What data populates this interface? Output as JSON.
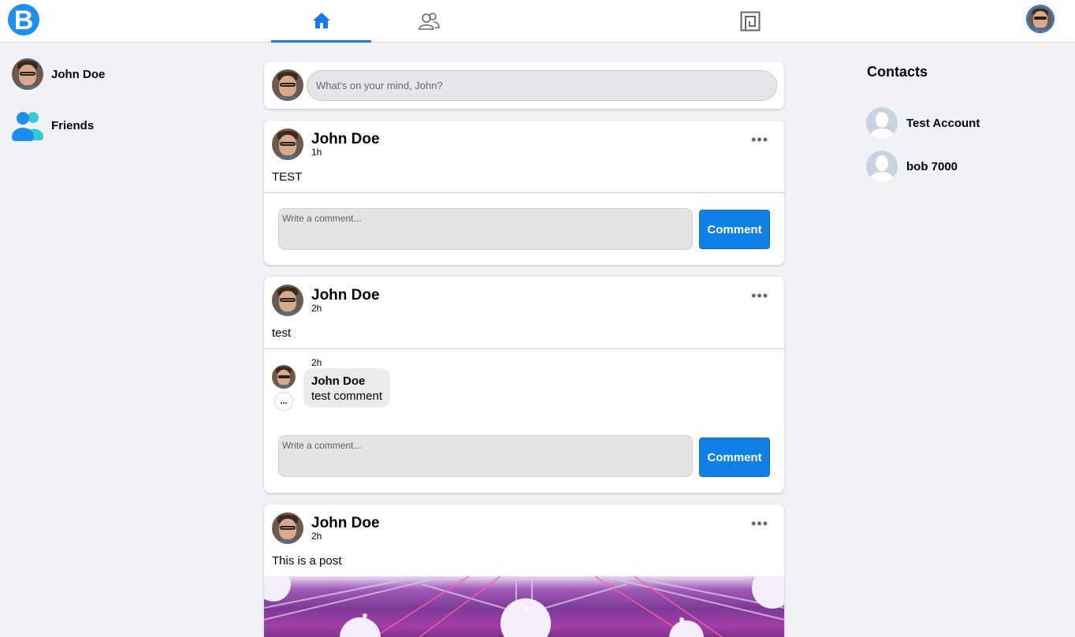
{
  "app": {
    "logo_letter": "B",
    "accent_color": "#1877f2",
    "comment_button_color": "#1080e8"
  },
  "nav": {
    "tabs": [
      {
        "name": "home",
        "icon": "home-icon",
        "active": true
      },
      {
        "name": "friends",
        "icon": "people-icon",
        "active": false
      },
      {
        "name": "marketplace",
        "icon": "square-frame-icon",
        "active": false
      }
    ]
  },
  "sidebar": {
    "items": [
      {
        "label": "John Doe",
        "icon": "avatar"
      },
      {
        "label": "Friends",
        "icon": "friends-icon"
      }
    ]
  },
  "composer": {
    "placeholder": "What's on your mind, John?"
  },
  "posts": [
    {
      "author": "John Doe",
      "time": "1h",
      "text": "TEST",
      "comments": [],
      "comment_placeholder": "Write a comment...",
      "comment_button": "Comment"
    },
    {
      "author": "John Doe",
      "time": "2h",
      "text": "test",
      "comments": [
        {
          "time": "2h",
          "author": "John Doe",
          "text": "test comment",
          "more": "..."
        }
      ],
      "comment_placeholder": "Write a comment...",
      "comment_button": "Comment"
    },
    {
      "author": "John Doe",
      "time": "2h",
      "text": "This is a post",
      "has_image": true
    }
  ],
  "contacts": {
    "title": "Contacts",
    "items": [
      {
        "name": "Test Account"
      },
      {
        "name": "bob 7000"
      }
    ]
  }
}
